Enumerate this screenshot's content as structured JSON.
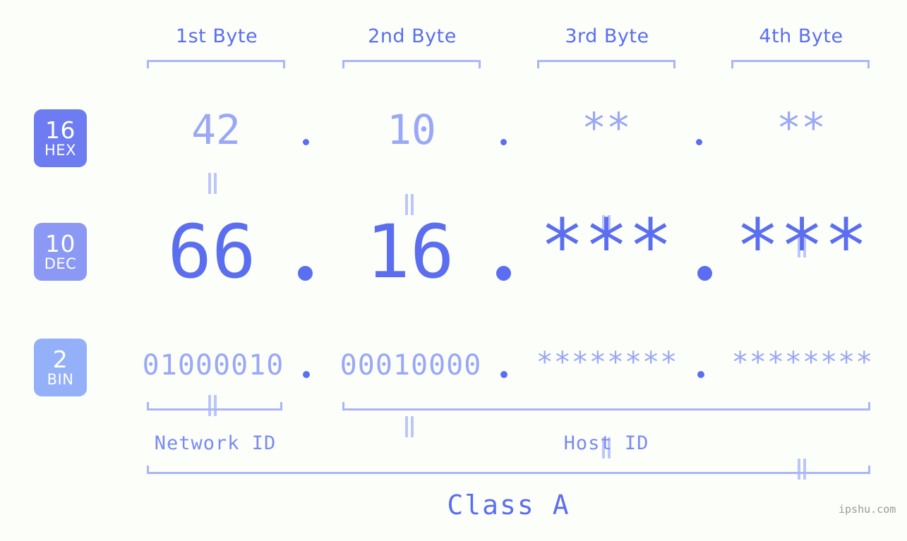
{
  "background_color": "#fcfefa",
  "accent_color": "#5b6ef0",
  "accent_light_color": "#9aa8f5",
  "bracket_color": "#aab6f7",
  "byte_headers": [
    {
      "label": "1st Byte"
    },
    {
      "label": "2nd Byte"
    },
    {
      "label": "3rd Byte"
    },
    {
      "label": "4th Byte"
    }
  ],
  "rows": [
    {
      "badge_number": "16",
      "badge_abbr": "HEX",
      "badge_color": "#6d7cf0",
      "values": [
        "42",
        "10",
        "**",
        "**"
      ],
      "separator": "."
    },
    {
      "badge_number": "10",
      "badge_abbr": "DEC",
      "badge_color": "#8b99f4",
      "values": [
        "66",
        "16",
        "***",
        "***"
      ],
      "separator": "."
    },
    {
      "badge_number": "2",
      "badge_abbr": "BIN",
      "badge_color": "#93b0f8",
      "values": [
        "01000010",
        "00010000",
        "********",
        "********"
      ],
      "separator": "."
    }
  ],
  "equals_mark": "||",
  "segments": {
    "network_id": "Network ID",
    "host_id": "Host ID"
  },
  "class_label": "Class A",
  "watermark": "ipshu.com"
}
